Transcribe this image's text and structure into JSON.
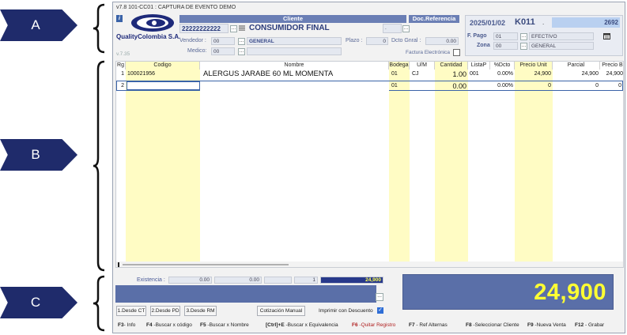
{
  "callouts": [
    "A",
    "B",
    "C"
  ],
  "window": {
    "title": "v7.8 101-CC01 : CAPTURA DE EVENTO DEMO",
    "version": "v.7.35"
  },
  "logo": {
    "text": "QualityColombia S.A."
  },
  "cliente": {
    "header": "Cliente",
    "nit": "22222222222",
    "nombre": "CONSUMIDOR FINAL",
    "vendedor_label": "Vendedor :",
    "vendedor_code": "00",
    "vendedor_name": "GENERAL",
    "medico_label": "Medico:",
    "medico_code": "00",
    "plazo_label": "Plazo :",
    "plazo_value": "0",
    "dcto_label": "Dcto Gnral :",
    "dcto_value": "0.00",
    "factura_label": "Factura Electrónica"
  },
  "docref": {
    "header": "Doc.Referencia",
    "value": "."
  },
  "doc": {
    "date": "2025/01/02",
    "code": "K011",
    "dot": ".",
    "number": "2692",
    "fpago_label": "F. Pago",
    "fpago_code": "01",
    "fpago_name": "EFECTIVO",
    "zona_label": "Zona",
    "zona_code": "00",
    "zona_name": "GENERAL"
  },
  "grid": {
    "headers": [
      "Rg",
      "Codigo",
      "Nombre",
      "Bodega",
      "U/M",
      "Cantidad",
      "ListaP",
      "%Dcto",
      "Precio Unit",
      "Parcial",
      "Precio B"
    ],
    "rows": [
      [
        "1",
        "100021956",
        "ALERGUS JARABE 60 ML MOMENTA",
        "01",
        "CJ",
        "1.00",
        "001",
        "0.00%",
        "24,900",
        "24,900",
        "24,900"
      ],
      [
        "2",
        "",
        "",
        "01",
        "",
        "0.00",
        "",
        "0.00%",
        "0",
        "0",
        "0"
      ]
    ]
  },
  "footer": {
    "existencia_label": "Existencia :",
    "exist_values": [
      "0.00",
      "0.00",
      "1",
      "24,900"
    ],
    "total": "24,900",
    "buttons": [
      "1.Desde CT",
      "2.Desde PD",
      "3.Desde RM",
      "Cotización Manual"
    ],
    "imprimir_label": "Imprimir con Descuento",
    "dots": "..."
  },
  "fkeys": [
    {
      "key": "F3",
      "text": "- Info"
    },
    {
      "key": "F4",
      "text": " -Buscar x código"
    },
    {
      "key": "F5",
      "text": " -Buscar x Nombre"
    },
    {
      "key": "[Ctrl]+E",
      "text": " -Buscar x Equivalencia"
    },
    {
      "key": "F6",
      "text": " -Quitar Registro"
    },
    {
      "key": "F7",
      "text": " - Ref Alternas"
    },
    {
      "key": "F8",
      "text": " -Seleccionar Cliente"
    },
    {
      "key": "F9",
      "text": " -Nueva Venta"
    },
    {
      "key": "F12",
      "text": " - Grabar"
    }
  ],
  "colors": {
    "accent": "#1f2b6b",
    "total_text": "#ffff33",
    "total_bg": "#5a6fa8",
    "yellow_col": "#fffcc4",
    "header_blue": "#6b7fb5"
  }
}
